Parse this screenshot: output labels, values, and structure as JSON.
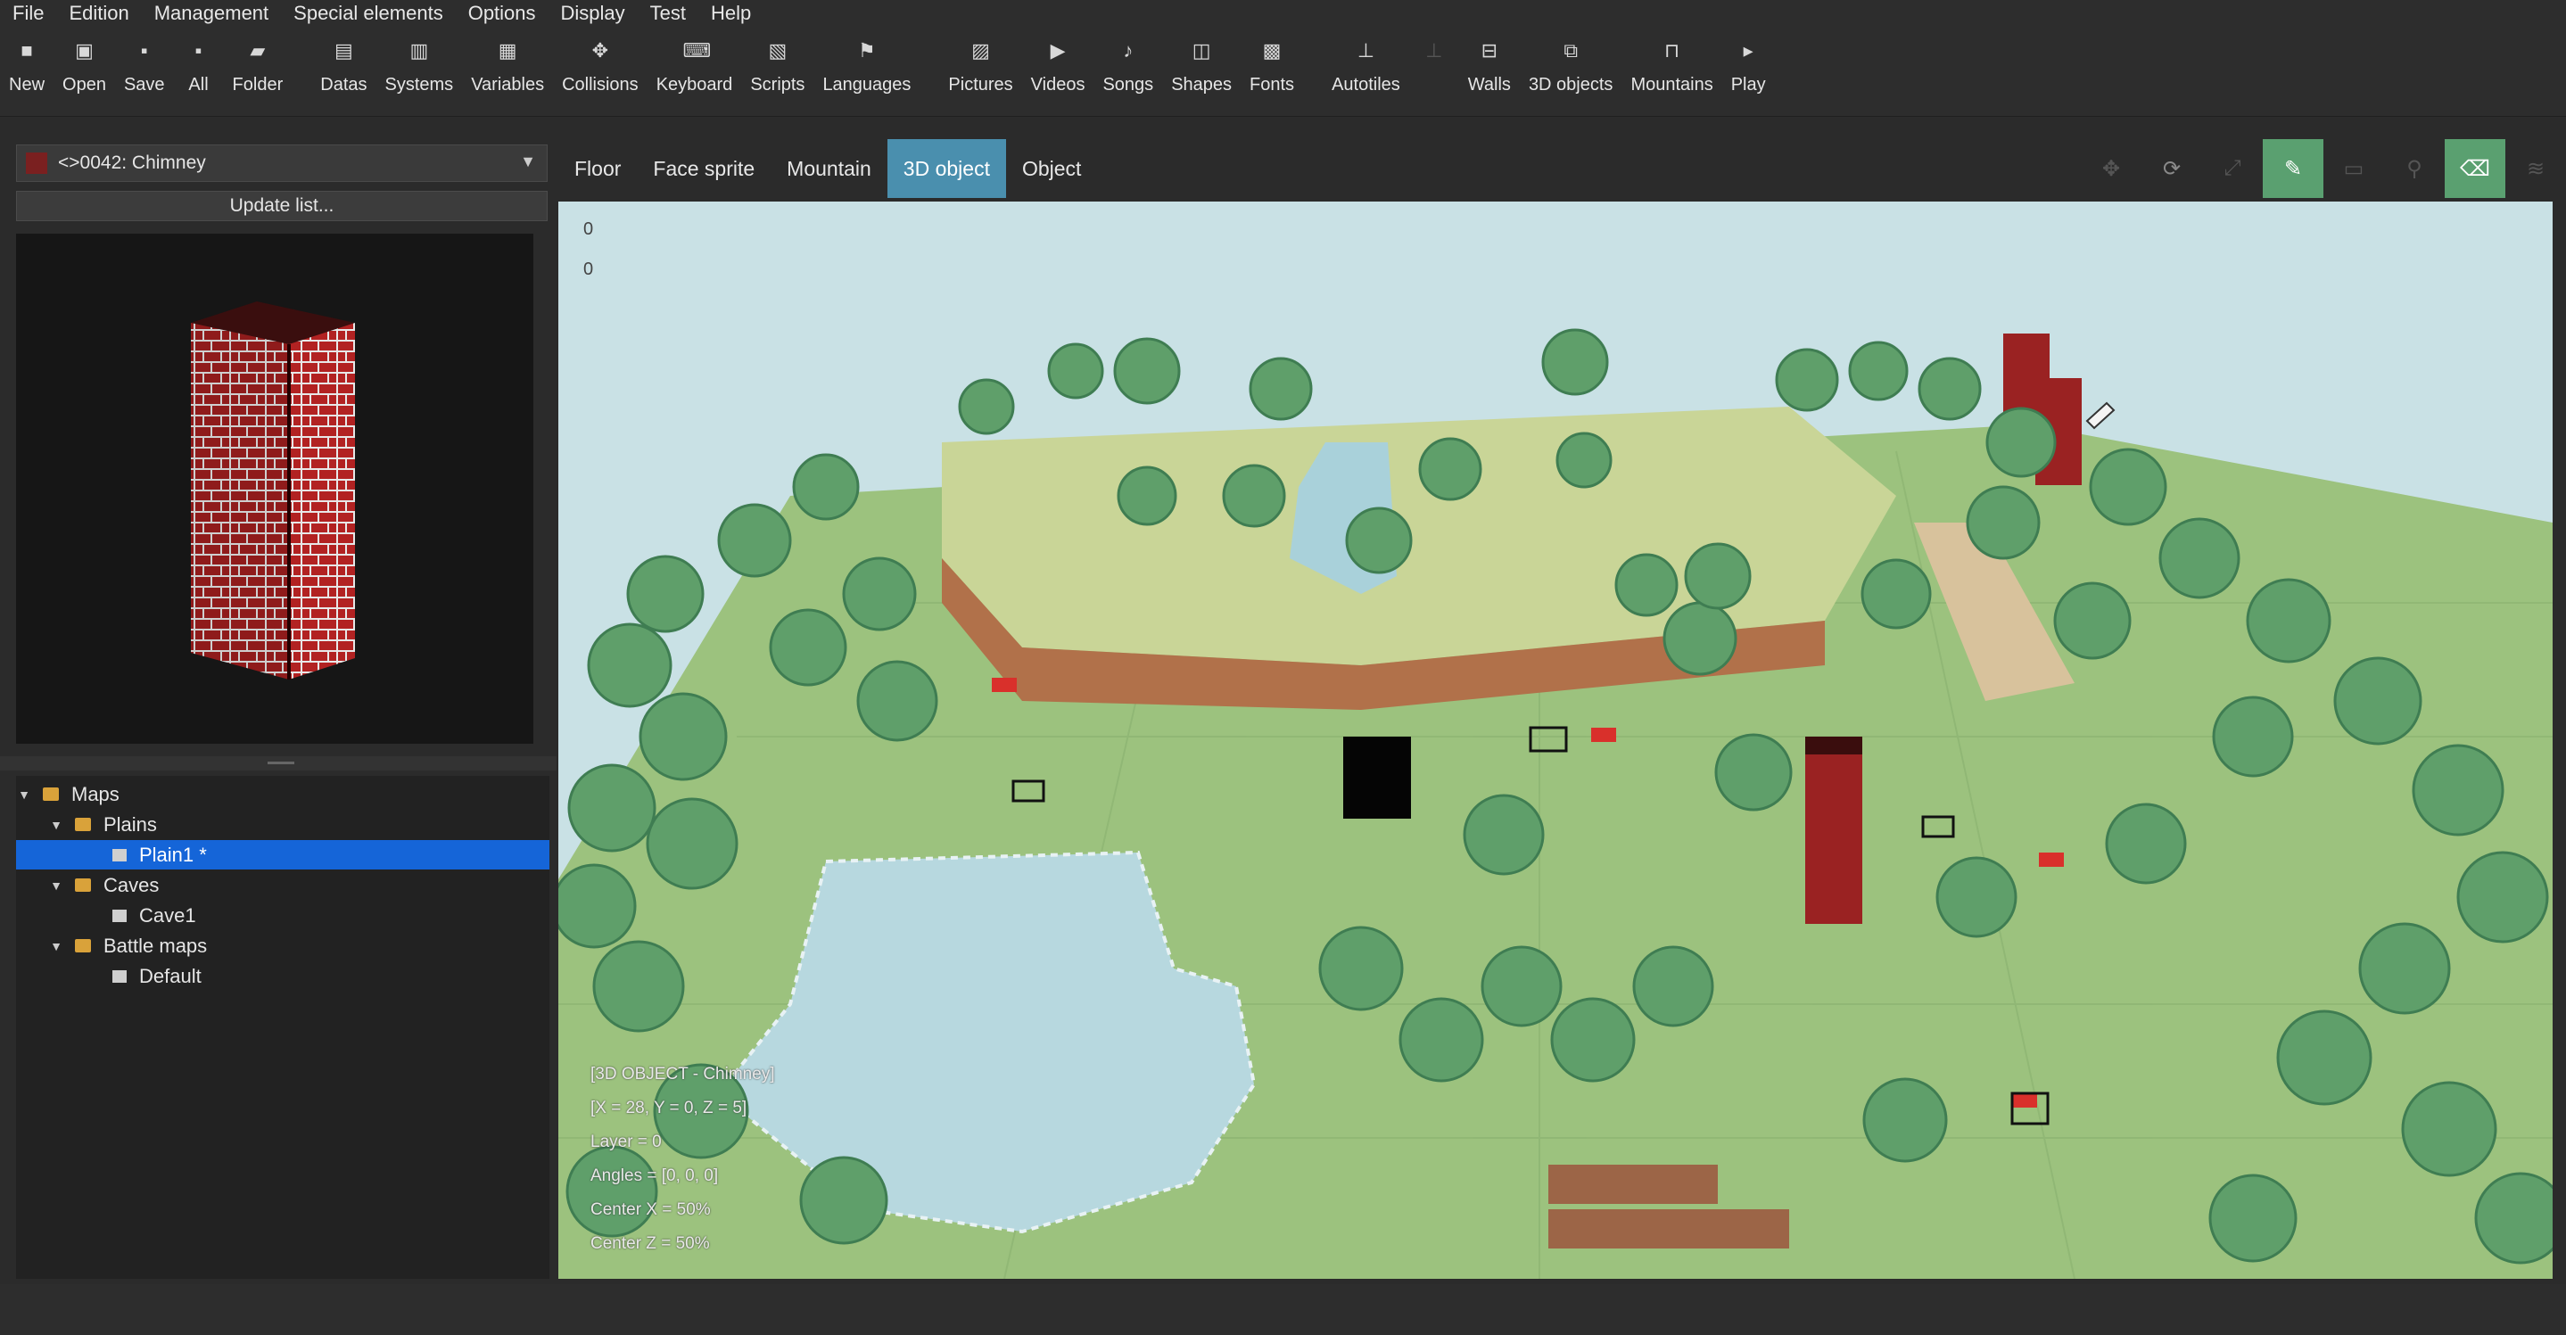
{
  "menu": [
    "File",
    "Edition",
    "Management",
    "Special elements",
    "Options",
    "Display",
    "Test",
    "Help"
  ],
  "toolbar": [
    {
      "label": "New",
      "icon": "new-file-icon",
      "glyph": "■"
    },
    {
      "label": "Open",
      "icon": "open-project-icon",
      "glyph": "▣"
    },
    {
      "label": "Save",
      "icon": "save-icon",
      "glyph": "▪"
    },
    {
      "label": "All",
      "icon": "save-all-icon",
      "glyph": "▪"
    },
    {
      "label": "Folder",
      "icon": "folder-icon",
      "glyph": "▰"
    },
    {
      "label": "Datas",
      "icon": "datas-icon",
      "glyph": "▤"
    },
    {
      "label": "Systems",
      "icon": "systems-icon",
      "glyph": "▥"
    },
    {
      "label": "Variables",
      "icon": "variables-icon",
      "glyph": "▦"
    },
    {
      "label": "Collisions",
      "icon": "collisions-icon",
      "glyph": "✥"
    },
    {
      "label": "Keyboard",
      "icon": "keyboard-icon",
      "glyph": "⌨"
    },
    {
      "label": "Scripts",
      "icon": "scripts-icon",
      "glyph": "▧"
    },
    {
      "label": "Languages",
      "icon": "languages-icon",
      "glyph": "⚑"
    },
    {
      "label": "Pictures",
      "icon": "pictures-icon",
      "glyph": "▨"
    },
    {
      "label": "Videos",
      "icon": "videos-icon",
      "glyph": "▶"
    },
    {
      "label": "Songs",
      "icon": "songs-icon",
      "glyph": "♪"
    },
    {
      "label": "Shapes",
      "icon": "shapes-icon",
      "glyph": "◫"
    },
    {
      "label": "Fonts",
      "icon": "fonts-icon",
      "glyph": "▩"
    },
    {
      "label": "Autotiles",
      "icon": "autotiles-icon",
      "glyph": "⊥"
    },
    {
      "label": "",
      "icon": "disabled-tool-icon",
      "glyph": "⊥",
      "disabled": true
    },
    {
      "label": "Walls",
      "icon": "walls-icon",
      "glyph": "⊟"
    },
    {
      "label": "3D objects",
      "icon": "3d-objects-icon",
      "glyph": "⧉"
    },
    {
      "label": "Mountains",
      "icon": "mountains-icon",
      "glyph": "⊓"
    },
    {
      "label": "Play",
      "icon": "play-icon",
      "glyph": "▸"
    }
  ],
  "left_panel": {
    "selected_object": "<>0042: Chimney",
    "update_button": "Update list..."
  },
  "tree": [
    {
      "label": "Maps",
      "level": 0,
      "type": "folder",
      "expanded": true
    },
    {
      "label": "Plains",
      "level": 1,
      "type": "folder",
      "expanded": true
    },
    {
      "label": "Plain1 *",
      "level": 2,
      "type": "map",
      "selected": true
    },
    {
      "label": "Caves",
      "level": 1,
      "type": "folder",
      "expanded": true
    },
    {
      "label": "Cave1",
      "level": 2,
      "type": "map"
    },
    {
      "label": "Battle maps",
      "level": 1,
      "type": "folder",
      "expanded": true
    },
    {
      "label": "Default",
      "level": 2,
      "type": "map"
    }
  ],
  "map_tabs": [
    {
      "label": "Floor"
    },
    {
      "label": "Face sprite"
    },
    {
      "label": "Mountain"
    },
    {
      "label": "3D object",
      "active": true
    },
    {
      "label": "Object"
    }
  ],
  "tool_icons": [
    {
      "icon": "translate-icon",
      "state": "dim"
    },
    {
      "icon": "rotate-icon",
      "state": "normal"
    },
    {
      "icon": "scale-icon",
      "state": "dim"
    },
    {
      "icon": "pencil-icon",
      "state": "on"
    },
    {
      "icon": "rectangle-icon",
      "state": "dim"
    },
    {
      "icon": "pin-icon",
      "state": "dim"
    },
    {
      "icon": "eraser-icon",
      "state": "on"
    },
    {
      "icon": "layers-icon",
      "state": "dim"
    }
  ],
  "viewport": {
    "axis_values": [
      "0",
      "0"
    ],
    "object_info": [
      "[3D OBJECT - Chimney]",
      "[X = 28, Y = 0, Z = 5]",
      "Layer = 0",
      "Angles = [0, 0, 0]",
      "Center X = 50%",
      "Center Z = 50%"
    ]
  },
  "colors": {
    "selection": "#1565d8",
    "active_tab": "#4a8fae",
    "active_tool": "#5aa070",
    "sky": "#c9e1e5",
    "grass": "#9cc27e",
    "tree": "#5f9f6a",
    "brick": "#9a2222"
  }
}
